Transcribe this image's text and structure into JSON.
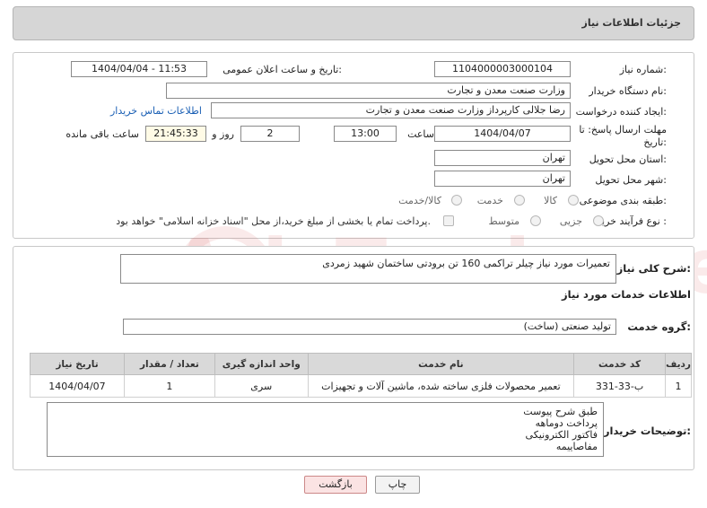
{
  "header": {
    "title": "جزئیات اطلاعات نیاز"
  },
  "form": {
    "need_number_label": "شماره نیاز:",
    "need_number": "1104000003000104",
    "announce_label": "تاریخ و ساعت اعلان عمومی:",
    "announce_value": "1404/04/04 - 11:53",
    "buyer_org_label": "نام دستگاه خریدار:",
    "buyer_org": "وزارت صنعت معدن و تجارت",
    "requester_label": "ایجاد کننده درخواست:",
    "requester": "رضا جلالی کارپرداز وزارت صنعت معدن و تجارت",
    "contact_link": "اطلاعات تماس خریدار",
    "deadline_label_1": "مهلت ارسال پاسخ: تا",
    "deadline_label_2": "تاریخ:",
    "deadline_date": "1404/04/07",
    "hour_label": "ساعت",
    "deadline_hour": "13:00",
    "days_value": "2",
    "days_label": "روز و",
    "remaining_time": "21:45:33",
    "remaining_label": "ساعت باقی مانده",
    "province_label": "استان محل تحویل:",
    "province": "تهران",
    "city_label": "شهر محل تحویل:",
    "city": "تهران",
    "category_label": "طبقه بندی موضوعی:",
    "category_options": [
      "کالا",
      "خدمت",
      "کالا/خدمت"
    ],
    "process_label": "نوع فرآیند خرید :",
    "process_options": [
      "جزیی",
      "متوسط"
    ],
    "payment_note": "پرداخت تمام یا بخشی از مبلغ خرید،از محل \"اسناد خزانه اسلامی\" خواهد بود."
  },
  "summary": {
    "label": "شرح کلی نیاز:",
    "text": "تعمیرات مورد نیاز چیلر تراکمی 160 تن برودتی ساختمان شهید زمردی"
  },
  "services": {
    "section_title": "اطلاعات خدمات مورد نیاز",
    "group_label": "گروه خدمت:",
    "group_value": "تولید صنعتی (ساخت)",
    "columns": [
      "ردیف",
      "کد خدمت",
      "نام خدمت",
      "واحد اندازه گیری",
      "تعداد / مقدار",
      "تاریخ نیاز"
    ],
    "rows": [
      [
        "1",
        "ب-33-331",
        "تعمیر محصولات فلزی ساخته شده، ماشین آلات و تجهیزات",
        "سری",
        "1",
        "1404/04/07"
      ]
    ]
  },
  "buyer_notes": {
    "label": "توضیحات خریدار:",
    "lines": [
      "طبق شرح پیوست",
      "پرداخت دوماهه",
      "فاکتور الکترونیکی",
      "مفاصاییمه"
    ]
  },
  "buttons": {
    "print": "چاپ",
    "back": "بازگشت"
  },
  "watermark": "AriaTender.net"
}
